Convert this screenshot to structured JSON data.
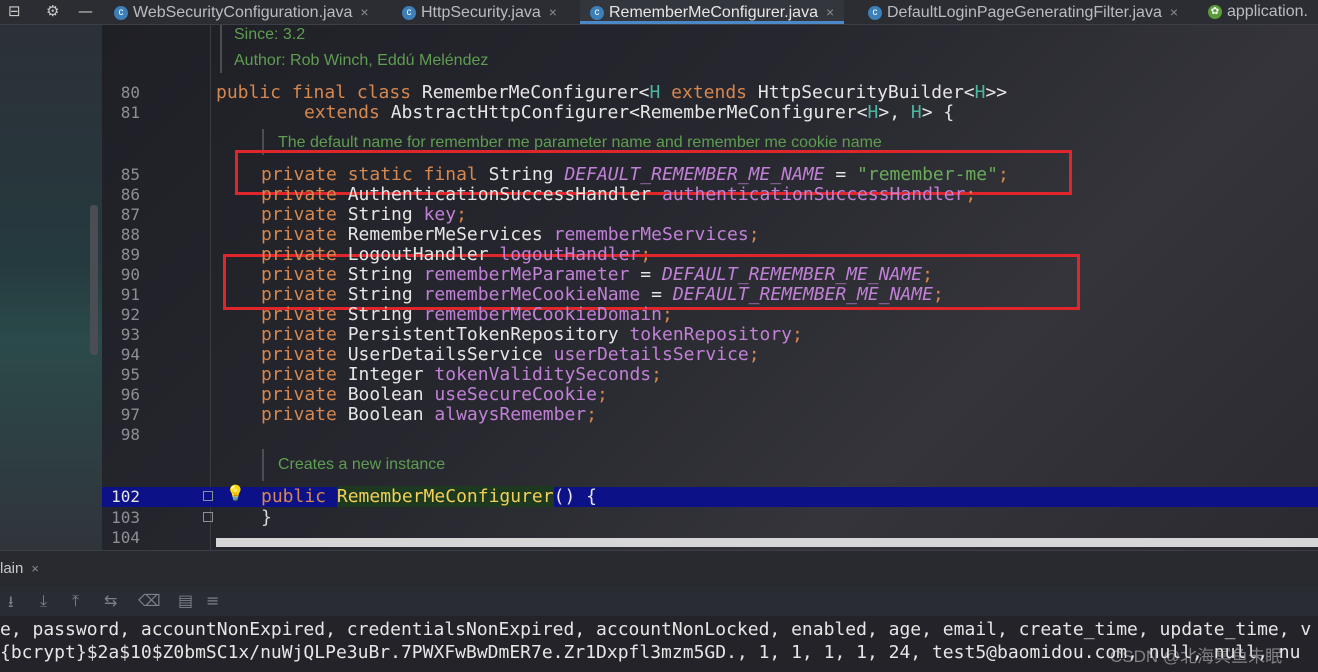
{
  "tabs": [
    {
      "label": "WebSecurityConfiguration.java",
      "icon": "class-icon",
      "active": false
    },
    {
      "label": "HttpSecurity.java",
      "icon": "class-icon",
      "active": false
    },
    {
      "label": "RememberMeConfigurer.java",
      "icon": "class-icon",
      "active": true
    },
    {
      "label": "DefaultLoginPageGeneratingFilter.java",
      "icon": "class-icon",
      "active": false
    },
    {
      "label": "application.",
      "icon": "spring-config-icon",
      "active": false
    }
  ],
  "doc": {
    "since": "Since:   3.2",
    "author": "Author: Rob Winch, Eddú Meléndez",
    "field_comment": "The default name for remember me parameter name and remember me cookie name",
    "ctor_comment": "Creates a new instance"
  },
  "line_numbers": [
    "80",
    "81",
    "85",
    "86",
    "87",
    "88",
    "89",
    "90",
    "91",
    "92",
    "93",
    "94",
    "95",
    "96",
    "97",
    "98",
    "102",
    "103",
    "104"
  ],
  "code": {
    "l80": {
      "a": "public final class ",
      "b": "RememberMeConfigurer<",
      "c": "H",
      "d": " extends ",
      "e": "HttpSecurityBuilder<",
      "f": "H",
      ">": ">>"
    },
    "l81": {
      "a": "extends ",
      "b": "AbstractHttpConfigurer<RememberMeConfigurer<",
      "c": "H",
      "d": ">, ",
      "e": "H",
      "f": "> {"
    },
    "l85": {
      "a": "private static final ",
      "b": "String ",
      "c": "DEFAULT_REMEMBER_ME_NAME",
      "d": " = ",
      "e": "\"remember-me\"",
      "f": ";"
    },
    "fields": [
      {
        "ln": "86",
        "type": "AuthenticationSuccessHandler ",
        "name": "authenticationSuccessHandler",
        "init": ""
      },
      {
        "ln": "87",
        "type": "String ",
        "name": "key",
        "init": ""
      },
      {
        "ln": "88",
        "type": "RememberMeServices ",
        "name": "rememberMeServices",
        "init": ""
      },
      {
        "ln": "89",
        "type": "LogoutHandler ",
        "name": "logoutHandler",
        "init": ""
      },
      {
        "ln": "90",
        "type": "String ",
        "name": "rememberMeParameter",
        "init": "DEFAULT_REMEMBER_ME_NAME"
      },
      {
        "ln": "91",
        "type": "String ",
        "name": "rememberMeCookieName",
        "init": "DEFAULT_REMEMBER_ME_NAME"
      },
      {
        "ln": "92",
        "type": "String ",
        "name": "rememberMeCookieDomain",
        "init": ""
      },
      {
        "ln": "93",
        "type": "PersistentTokenRepository ",
        "name": "tokenRepository",
        "init": ""
      },
      {
        "ln": "94",
        "type": "UserDetailsService ",
        "name": "userDetailsService",
        "init": ""
      },
      {
        "ln": "95",
        "type": "Integer ",
        "name": "tokenValiditySeconds",
        "init": ""
      },
      {
        "ln": "96",
        "type": "Boolean ",
        "name": "useSecureCookie",
        "init": ""
      },
      {
        "ln": "97",
        "type": "Boolean ",
        "name": "alwaysRemember",
        "init": ""
      }
    ],
    "kw_private": "private",
    "eq": " = ",
    "semi": ";",
    "l102": {
      "a": "public ",
      "b": "RememberMeConfigurer",
      "c": "() {"
    },
    "l103": "}"
  },
  "run": {
    "title": "lain",
    "close": "×"
  },
  "console": {
    "line1": "e, password, accountNonExpired, credentialsNonExpired, accountNonLocked, enabled, age, email, create_time, update_time, v",
    "line2": "{bcrypt}$2a$10$Z0bmSC1x/nuWjQLPe3uBr.7PWXFwBwDmER7e.Zr1Dxpfl3mzm5GD., 1, 1, 1, 1, 24, test5@baomidou.com, null, null, nu"
  },
  "watermark": "CSDN @北海冥鱼未眠",
  "colors": {
    "keyword": "#d6884f",
    "field": "#c081d6",
    "string": "#6aab5a",
    "doc": "#5f9e52",
    "highlight_row": "#0d1188",
    "annotation_box": "#e0262b"
  }
}
